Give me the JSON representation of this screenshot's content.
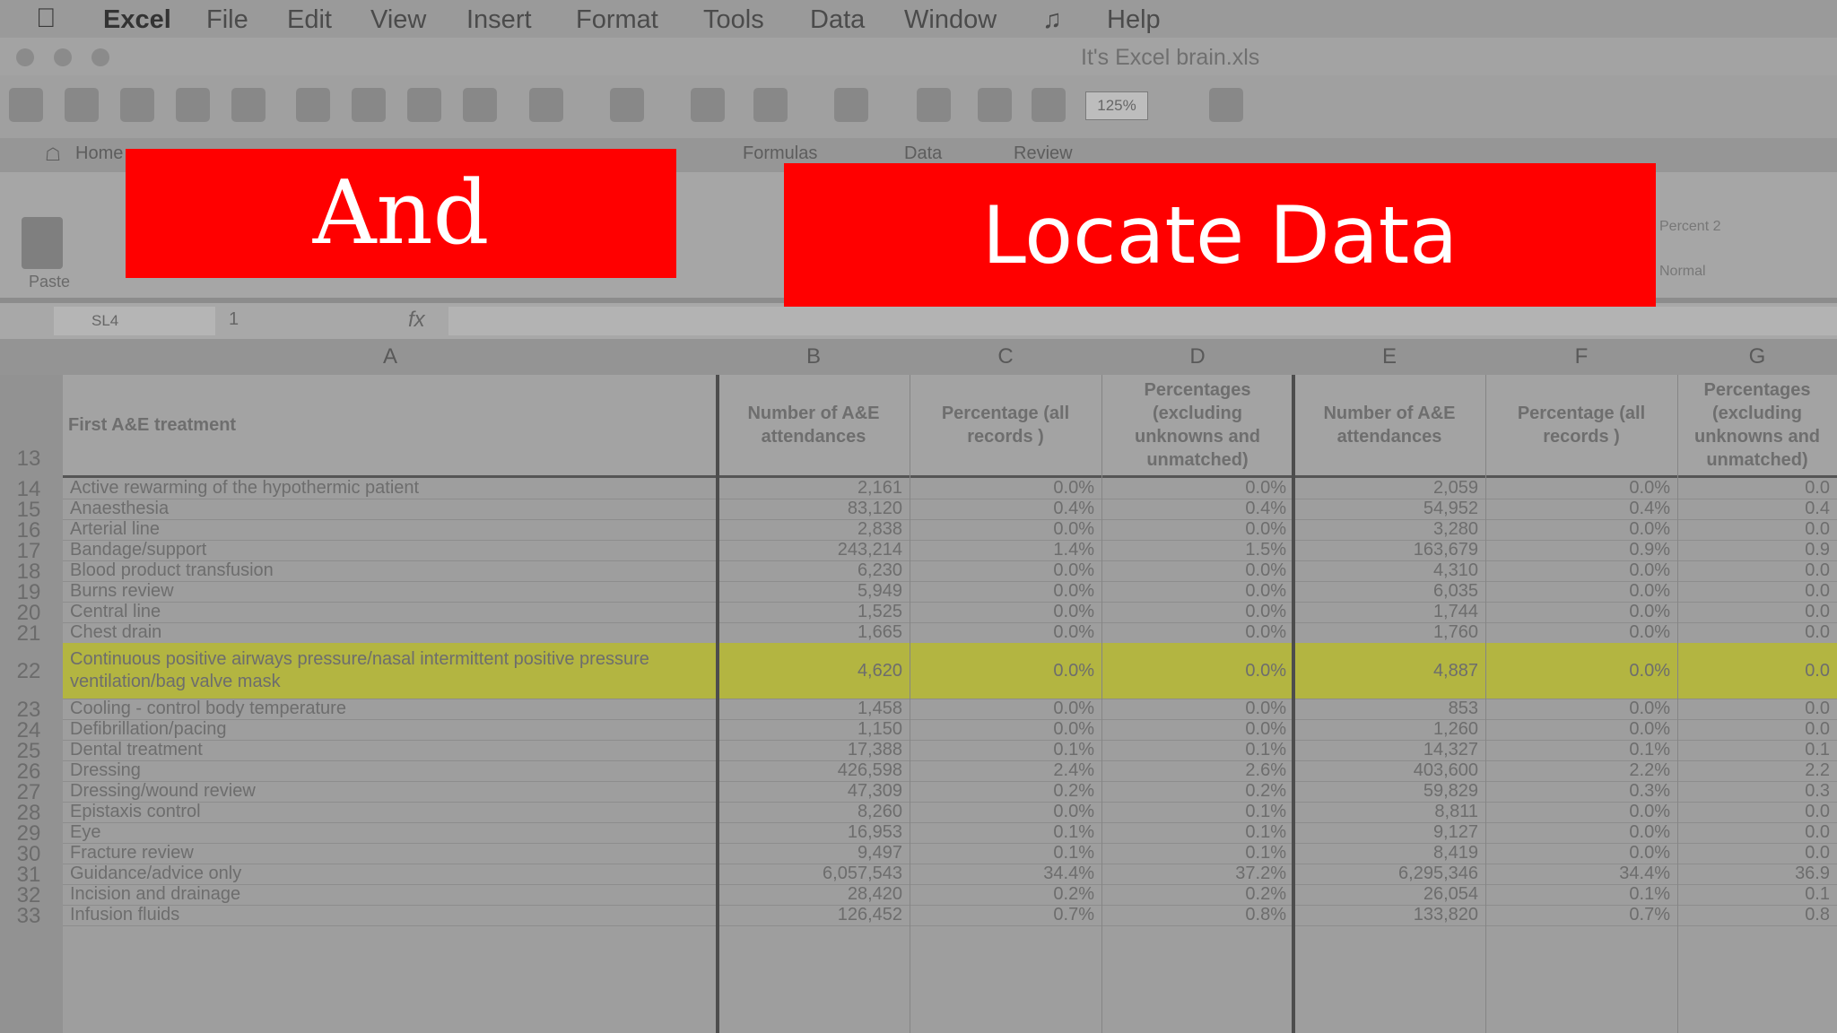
{
  "menubar": {
    "app": "Excel",
    "items": [
      "File",
      "Edit",
      "View",
      "Insert",
      "Format",
      "Tools",
      "Data",
      "Window",
      "Help"
    ]
  },
  "window": {
    "title": "It's Excel brain.xls"
  },
  "toolbar": {
    "zoom": "125%"
  },
  "ribbon": {
    "tabs": [
      "Home",
      "Formulas",
      "Data",
      "Review"
    ],
    "paste_label": "Paste",
    "styles": [
      "Percent 2",
      "Normal"
    ]
  },
  "formula_bar": {
    "cell_ref": "1",
    "namebox": "SL4"
  },
  "columns": [
    "A",
    "B",
    "C",
    "D",
    "E",
    "F",
    "G"
  ],
  "header_row": {
    "row_number": "13",
    "cells": [
      "First A&E treatment",
      "Number of A&E attendances",
      "Percentage (all records )",
      "Percentages (excluding unknowns and unmatched)",
      "Number of A&E attendances",
      "Percentage (all records )",
      "Percentages (excluding unknowns and unmatched)"
    ]
  },
  "rows": [
    {
      "num": "14",
      "cells": [
        "Active rewarming of the hypothermic patient",
        "2,161",
        "0.0%",
        "0.0%",
        "2,059",
        "0.0%",
        "0.0"
      ]
    },
    {
      "num": "15",
      "cells": [
        "Anaesthesia",
        "83,120",
        "0.4%",
        "0.4%",
        "54,952",
        "0.4%",
        "0.4"
      ]
    },
    {
      "num": "16",
      "cells": [
        "Arterial line",
        "2,838",
        "0.0%",
        "0.0%",
        "3,280",
        "0.0%",
        "0.0"
      ]
    },
    {
      "num": "17",
      "cells": [
        "Bandage/support",
        "243,214",
        "1.4%",
        "1.5%",
        "163,679",
        "0.9%",
        "0.9"
      ]
    },
    {
      "num": "18",
      "cells": [
        "Blood product transfusion",
        "6,230",
        "0.0%",
        "0.0%",
        "4,310",
        "0.0%",
        "0.0"
      ]
    },
    {
      "num": "19",
      "cells": [
        "Burns review",
        "5,949",
        "0.0%",
        "0.0%",
        "6,035",
        "0.0%",
        "0.0"
      ]
    },
    {
      "num": "20",
      "cells": [
        "Central line",
        "1,525",
        "0.0%",
        "0.0%",
        "1,744",
        "0.0%",
        "0.0"
      ]
    },
    {
      "num": "21",
      "cells": [
        "Chest drain",
        "1,665",
        "0.0%",
        "0.0%",
        "1,760",
        "0.0%",
        "0.0"
      ]
    },
    {
      "num": "22",
      "highlight": true,
      "cells": [
        "Continuous positive airways pressure/nasal intermittent positive pressure ventilation/bag valve mask",
        "4,620",
        "0.0%",
        "0.0%",
        "4,887",
        "0.0%",
        "0.0"
      ]
    },
    {
      "num": "23",
      "cells": [
        "Cooling - control body temperature",
        "1,458",
        "0.0%",
        "0.0%",
        "853",
        "0.0%",
        "0.0"
      ]
    },
    {
      "num": "24",
      "cells": [
        "Defibrillation/pacing",
        "1,150",
        "0.0%",
        "0.0%",
        "1,260",
        "0.0%",
        "0.0"
      ]
    },
    {
      "num": "25",
      "cells": [
        "Dental treatment",
        "17,388",
        "0.1%",
        "0.1%",
        "14,327",
        "0.1%",
        "0.1"
      ]
    },
    {
      "num": "26",
      "cells": [
        "Dressing",
        "426,598",
        "2.4%",
        "2.6%",
        "403,600",
        "2.2%",
        "2.2"
      ]
    },
    {
      "num": "27",
      "cells": [
        "Dressing/wound review",
        "47,309",
        "0.2%",
        "0.2%",
        "59,829",
        "0.3%",
        "0.3"
      ]
    },
    {
      "num": "28",
      "cells": [
        "Epistaxis control",
        "8,260",
        "0.0%",
        "0.1%",
        "8,811",
        "0.0%",
        "0.0"
      ]
    },
    {
      "num": "29",
      "cells": [
        "Eye",
        "16,953",
        "0.1%",
        "0.1%",
        "9,127",
        "0.0%",
        "0.0"
      ]
    },
    {
      "num": "30",
      "cells": [
        "Fracture review",
        "9,497",
        "0.1%",
        "0.1%",
        "8,419",
        "0.0%",
        "0.0"
      ]
    },
    {
      "num": "31",
      "cells": [
        "Guidance/advice only",
        "6,057,543",
        "34.4%",
        "37.2%",
        "6,295,346",
        "34.4%",
        "36.9"
      ]
    },
    {
      "num": "32",
      "cells": [
        "Incision and drainage",
        "28,420",
        "0.2%",
        "0.2%",
        "26,054",
        "0.1%",
        "0.1"
      ]
    },
    {
      "num": "33",
      "cells": [
        "Infusion fluids",
        "126,452",
        "0.7%",
        "0.8%",
        "133,820",
        "0.7%",
        "0.8"
      ]
    }
  ],
  "captions": {
    "left": "And",
    "right": "Locate Data",
    "color": "#ff0000"
  }
}
